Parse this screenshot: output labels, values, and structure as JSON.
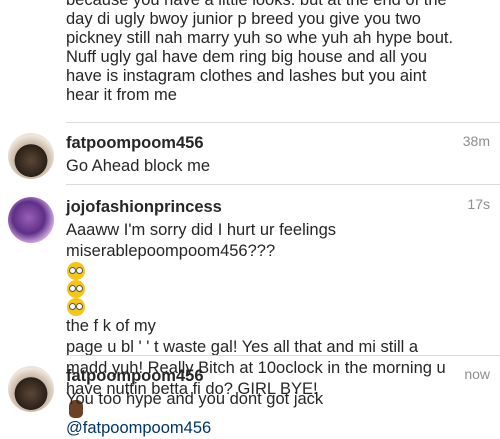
{
  "previous_comment": {
    "lines": [
      "because you have a little looks. but at the end of the",
      "day di ugly bwoy  junior p breed you give you two",
      "pickney still nah marry yuh so whe yuh ah hype bout.",
      "Nuff ugly gal have dem ring big house and all you",
      "have is instagram clothes and lashes but you aint",
      "hear it from me"
    ]
  },
  "comments": [
    {
      "username": "fatpoompoom456",
      "time": "38m",
      "lines": [
        "Go Ahead block me"
      ]
    },
    {
      "username": "jojofashionprincess",
      "time": "17s",
      "line1": "Aaaww I'm sorry did I hurt ur feelings",
      "line2_prefix": "miserablepoompoom456???",
      "line2_suffix": "the f   k of my",
      "line3": "page u bl        '    '    t waste gal! Yes all that and mi still a",
      "line4": "madd yuh! Really Bitch at 10oclock in the morning u",
      "line5": "have nuttin betta fi do? GIRL BYE!",
      "mention": "@fatpoompoom456"
    },
    {
      "username": "fatpoompoom456",
      "time": "now",
      "lines": [
        "You too hype and you dont got jack"
      ]
    }
  ],
  "icons": {
    "rolling_eyes": "rolling-eyes-emoji",
    "hand": "raised-hand-emoji"
  }
}
